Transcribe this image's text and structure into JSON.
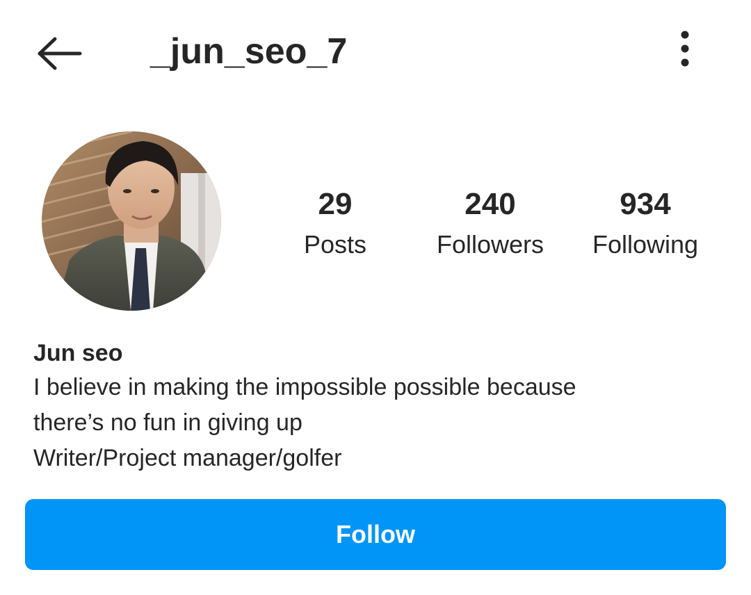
{
  "header": {
    "username": "_jun_seo_7",
    "back_icon": "arrow-left-icon",
    "more_icon": "more-vertical-icon"
  },
  "profile": {
    "avatar_icon": "profile-photo",
    "stats": {
      "posts_count": "29",
      "posts_label": "Posts",
      "followers_count": "240",
      "followers_label": "Followers",
      "following_count": "934",
      "following_label": "Following"
    },
    "display_name": "Jun seo",
    "bio_lines": [
      "I believe in making the impossible possible because",
      "there’s no fun in giving up",
      "Writer/Project manager/golfer"
    ]
  },
  "actions": {
    "follow_label": "Follow"
  },
  "colors": {
    "accent": "#0095f6",
    "text": "#262626",
    "background": "#ffffff"
  }
}
